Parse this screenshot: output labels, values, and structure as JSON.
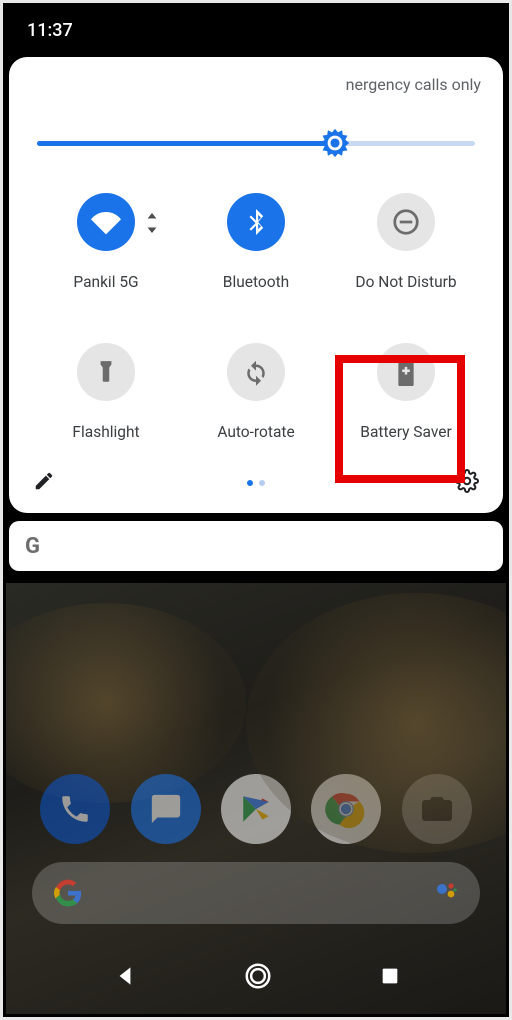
{
  "status": {
    "time": "11:37"
  },
  "qs": {
    "header_text": "nergency calls only",
    "brightness_percent": 68,
    "tiles": [
      {
        "id": "wifi",
        "label": "Pankil 5G",
        "active": true,
        "icon": "wifi",
        "expandable": true
      },
      {
        "id": "bluetooth",
        "label": "Bluetooth",
        "active": true,
        "icon": "bluetooth",
        "expandable": false
      },
      {
        "id": "dnd",
        "label": "Do Not Disturb",
        "active": false,
        "icon": "dnd",
        "expandable": false
      },
      {
        "id": "flashlight",
        "label": "Flashlight",
        "active": false,
        "icon": "flashlight",
        "expandable": false
      },
      {
        "id": "autorotate",
        "label": "Auto-rotate",
        "active": false,
        "icon": "autorotate",
        "expandable": false
      },
      {
        "id": "batterysaver",
        "label": "Battery Saver",
        "active": false,
        "icon": "battery",
        "expandable": false,
        "highlighted": true
      }
    ],
    "page_count": 2,
    "page_current": 0
  },
  "search": {
    "logo": "G"
  },
  "dock": {
    "apps": [
      "phone",
      "messages",
      "play",
      "chrome",
      "camera"
    ]
  },
  "colors": {
    "accent": "#1a73e8",
    "tile_off_bg": "#e5e5e5",
    "highlight": "#e60000"
  }
}
